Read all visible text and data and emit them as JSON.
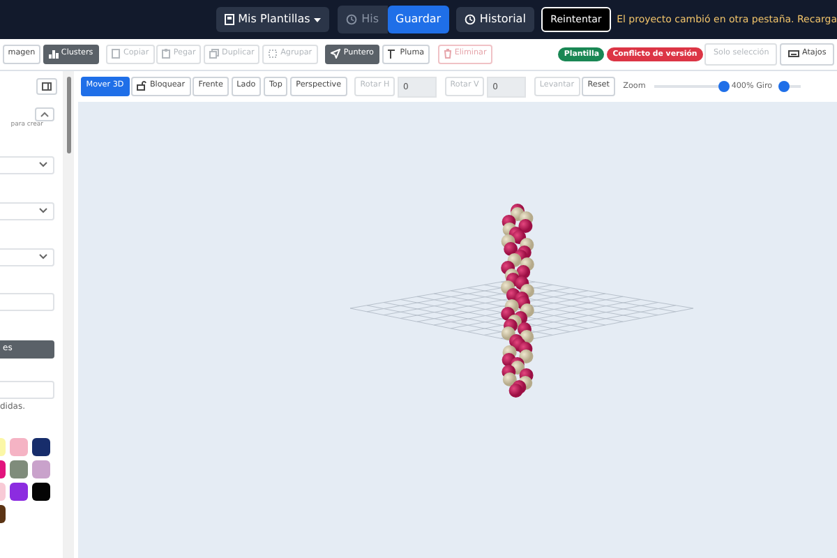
{
  "navbar": {
    "templates_button": "Mis Plantillas",
    "history_clipped": "His",
    "save_button": "Guardar",
    "history_button": "Historial",
    "retry_button": "Reintentar",
    "warning": "El proyecto cambió en otra pestaña. Recarga"
  },
  "toolbar": {
    "tools": [
      {
        "label": "magen",
        "selected": false,
        "disabled": false
      },
      {
        "label": "Clusters",
        "selected": true,
        "disabled": false
      },
      {
        "label": "Copiar",
        "selected": false,
        "disabled": true
      },
      {
        "label": "Pegar",
        "selected": false,
        "disabled": true
      },
      {
        "label": "Duplicar",
        "selected": false,
        "disabled": true
      },
      {
        "label": "Agrupar",
        "selected": false,
        "disabled": true
      },
      {
        "label": "Puntero",
        "selected": true,
        "disabled": false
      },
      {
        "label": "Pluma",
        "selected": false,
        "disabled": false
      },
      {
        "label": "Eliminar",
        "selected": false,
        "disabled": true
      }
    ],
    "badges": [
      {
        "label": "Plantilla",
        "color": "#198754"
      },
      {
        "label": "Conflicto de versión",
        "color": "#dc3545"
      }
    ],
    "right_buttons": [
      {
        "label": "Solo selección",
        "disabled": true
      },
      {
        "label": "Atajos",
        "disabled": false
      }
    ]
  },
  "sidebar": {
    "hint": "para crear",
    "button": "es",
    "note": "didas.",
    "swatches": [
      {
        "color": "#fbf7a6"
      },
      {
        "color": "#f5b3c4"
      },
      {
        "color": "#172d6b"
      },
      {
        "color": "#e2137d"
      },
      {
        "color": "#7f8c7b"
      },
      {
        "color": "#c9a2cb"
      },
      {
        "color": "#f8cad6"
      },
      {
        "color": "#8c2ce0"
      },
      {
        "color": "#050505"
      },
      {
        "color": "#5b3414"
      }
    ]
  },
  "view_toolbar": {
    "buttons": [
      {
        "label": "Mover 3D",
        "selected": true,
        "disabled": false
      },
      {
        "label": "Bloquear",
        "selected": false,
        "disabled": false
      },
      {
        "label": "Frente",
        "selected": false,
        "disabled": false
      },
      {
        "label": "Lado",
        "selected": false,
        "disabled": false
      },
      {
        "label": "Top",
        "selected": false,
        "disabled": false
      },
      {
        "label": "Perspective",
        "selected": false,
        "disabled": false
      }
    ],
    "rotate_h": {
      "label": "Rotar H",
      "value": "0",
      "disabled": true
    },
    "rotate_v": {
      "label": "Rotar V",
      "value": "0",
      "disabled": true
    },
    "lift_button": {
      "label": "Levantar",
      "disabled": true
    },
    "reset_button": "Reset",
    "zoom": {
      "label": "Zoom",
      "level": 1.0,
      "reading": "400%"
    },
    "spin": {
      "label": "Giro",
      "level": 0.0
    }
  }
}
